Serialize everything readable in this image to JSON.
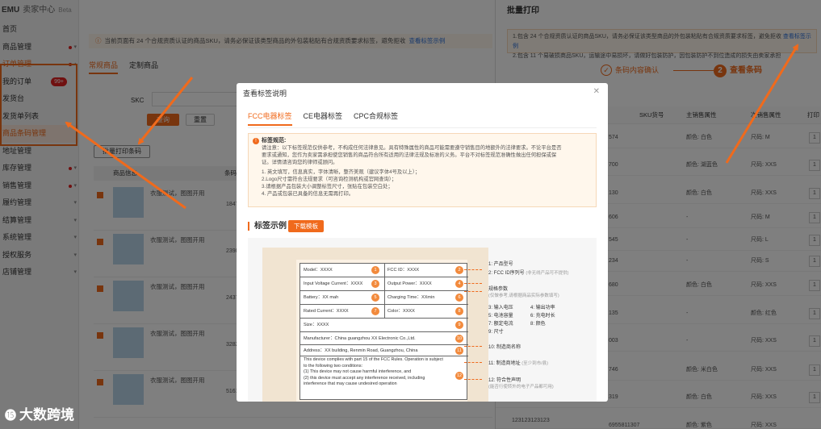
{
  "sidebar": {
    "logo": "EMU",
    "logo_sub": "卖家中心",
    "logo_badge": "Beta",
    "items": [
      {
        "label": "首页"
      },
      {
        "label": "商品管理"
      },
      {
        "label": "订单管理"
      },
      {
        "label": "我的订单",
        "count": "99+"
      },
      {
        "label": "发货台"
      },
      {
        "label": "发货单列表"
      },
      {
        "label": "商品条码管理"
      },
      {
        "label": "地址管理"
      },
      {
        "label": "库存管理"
      },
      {
        "label": "销售管理"
      },
      {
        "label": "履约管理"
      },
      {
        "label": "结算管理"
      },
      {
        "label": "系统管理"
      },
      {
        "label": "授权服务"
      },
      {
        "label": "店铺管理"
      }
    ]
  },
  "main": {
    "notice": "当前页面有 24 个合规资质认证的商品SKU，请务必保证该类型商品的外包装粘贴有合规资质要求标签，避免拒收",
    "notice_link": "查看标签示例",
    "tabs": [
      "常规商品",
      "定制商品"
    ],
    "skc_label": "SKC",
    "query_button": "查询",
    "reset_button": "重置",
    "batch_print_button": "批量打印条码",
    "table_headers": [
      "商品信息",
      "条码"
    ],
    "products": [
      {
        "name": "衣服测试，图图开用",
        "num": "1847"
      },
      {
        "name": "衣服测试，图图开用",
        "num": "2398"
      },
      {
        "name": "衣服测试，图图开用",
        "num": "2437"
      },
      {
        "name": "衣服测试，图图开用",
        "num": "3282"
      },
      {
        "name": "衣服测试，图图开用",
        "num": "5161"
      }
    ]
  },
  "drawer": {
    "title": "批量打印",
    "notice_line1": "1.包含 24 个合规资质认证的商品SKU，请务必保证该类型商品的外包装粘贴有合规资质要求标签，避免拒收",
    "notice_link": "查看标签示例",
    "notice_line2": "2.包含 11 个易破损商品SKU，运输途中易损坏，请做好包装防护，因包装防护不到位造成的损失由卖家承担",
    "step1": "条码内容确认",
    "step2": "查看条码",
    "headers": [
      "SKU货号",
      "主销售属性",
      "次销售属性",
      "打印"
    ],
    "rows": [
      {
        "sku": "574",
        "main": "颜色: 白色",
        "sub": "尺码: M",
        "qty": "1"
      },
      {
        "sku": "700",
        "main": "颜色: 湖蓝色",
        "sub": "尺码: XXS",
        "qty": "1"
      },
      {
        "sku": "130",
        "main": "颜色: 白色",
        "sub": "尺码: XXS",
        "qty": "1"
      },
      {
        "sku": "606",
        "main": "-",
        "sub": "尺码: M",
        "qty": "1"
      },
      {
        "sku": "545",
        "main": "-",
        "sub": "尺码: L",
        "qty": "1"
      },
      {
        "sku": "234",
        "main": "-",
        "sub": "尺码: S",
        "qty": "1"
      },
      {
        "sku": "680",
        "main": "颜色: 白色",
        "sub": "尺码: XXS",
        "qty": "1"
      },
      {
        "sku": "135",
        "main": "-",
        "sub": "颜色: 红色",
        "qty": "1"
      },
      {
        "sku": "003",
        "main": "-",
        "sub": "尺码: XXS",
        "qty": "1"
      },
      {
        "sku": "746",
        "main": "颜色: 米白色",
        "sub": "尺码: XXS",
        "qty": "1"
      },
      {
        "sku": "319",
        "main": "颜色: 白色",
        "sub": "尺码: XXS",
        "qty": "1"
      }
    ],
    "last_row_id": "123123123123",
    "last_row_sku": "6955811307",
    "last_row_main": "颜色: 紫色",
    "last_row_sub": "尺码: XXS"
  },
  "modal": {
    "title": "查看标签说明",
    "tabs": [
      "FCC电器标签",
      "CE电器标签",
      "CPC合规标签"
    ],
    "notice_head": "标签规范:",
    "notice_body1": "请注意：以下标签规范仅供参考，不构成任何法律意见。具有特殊属性的商品可能需要遵守销售目的地额外的法律要求。不论平台是否",
    "notice_body2": "要求或通知，您作为卖家需承担使您销售的商品符合所有适用的法律法规及标准的义务。平台不对标签规范准确性做出任何担保或保",
    "notice_body3": "证。详情请咨询您的律师或顾问。",
    "rules": [
      "1. 英文填写，信息真实，字体清晰，整齐美观（建议字体4号及以上）；",
      "2.Logo尺寸需符合法规要求（可咨询检测机构或官网查询）；",
      "3.请根据产品包装大小调整标签尺寸，张贴在包装空白处；",
      "4. 产品或包装已具备的信息无需再打印。"
    ],
    "section_title": "标签示例",
    "download_button": "下载模板",
    "label": {
      "model": "Model：XXXX",
      "fcc_id": "FCC ID：XXXX",
      "input_voltage": "Input Voltage Current：XXXX",
      "output_power": "Output Power：XXXX",
      "battery": "Battery：XX mah",
      "charging_time": "Charging Time：XXmin",
      "rated_current": "Rated Current：XXXX",
      "color": "Color：XXXX",
      "size": "Size：XXXX",
      "manufacturer": "Manufacturer：China guangzhou XX Electronic Co.,Ltd.",
      "address": "Address：XX building, Renmin Road, Guangzhou, China",
      "fcc1": "This device complies with part 15 of the FCC Rules. Operation is subject",
      "fcc2": "to the following two conditions:",
      "fcc3": "(1)  This device may not cause harmful interference, and",
      "fcc4": "(2)  this device must accept any interference received, including",
      "fcc5": "interference that may cause undesired operation"
    },
    "numbers": [
      "1",
      "2",
      "3",
      "4",
      "5",
      "6",
      "7",
      "8",
      "9",
      "10",
      "11",
      "12"
    ],
    "callouts": {
      "c1": "1: 产品型号",
      "c2": "2: FCC ID序列号",
      "c2_note": "(非无线产品可不提供)",
      "c3": "规格参数",
      "c3_note": "(仅做参考,请根据商品实际参数填写)",
      "p3": "3: 输入电压",
      "p4": "4: 输出功率",
      "p5": "5: 电池容量",
      "p6": "6: 充电时长",
      "p7": "7: 额定电流",
      "p8": "8: 颜色",
      "p9": "9: 尺寸",
      "c10": "10: 制造商名称",
      "c11": "11: 制造商地址",
      "c11_note": "(至少到市/县)",
      "c12": "12: 符合性声明",
      "c12_note": "(能否行使转外的电子产品都可用)"
    }
  },
  "watermark": "大数跨境"
}
